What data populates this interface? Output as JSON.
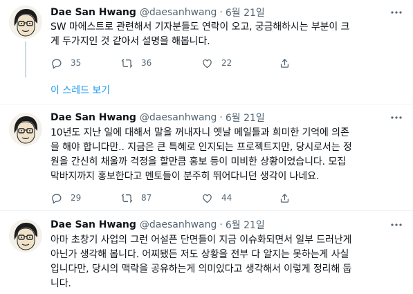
{
  "author": {
    "name": "Dae San Hwang",
    "handle": "@daesanhwang",
    "separator": "·"
  },
  "tweets": [
    {
      "date": "6월 21일",
      "lines": [
        "SW 마에스트로 관련해서 기자분들도 연락이 오고, 궁금해하시는 부분이 크",
        "게 두가지인 것 같아서 설명을 해봅니다."
      ],
      "replies": "35",
      "retweets": "36",
      "likes": "22"
    },
    {
      "date": "6월 21일",
      "lines": [
        "10년도 지난 일에 대해서 말을 꺼내자니 옛날 메일들과 희미한 기억에 의존",
        "을 해야 합니다만.. 지금은 큰 특혜로 인지되는 프로젝트지만, 당시로서는 정",
        "원을 간신히 채울까 걱정을 할만큼 홍보 등이 미비한 상황이었습니다. 모집",
        "막바지까지 홍보한다고 멘토들이 분주히 뛰어다니던 생각이 나네요."
      ],
      "replies": "29",
      "retweets": "87",
      "likes": "44"
    },
    {
      "date": "6월 21일",
      "lines": [
        "아마 초창기 사업의 그런 어설픈 단면들이 지금 이슈화되면서 일부 드러난게",
        "아닌가 생각해 봅니다. 어찌됐든 저도 상황을 전부 다 알지는 못하는게 사실",
        "입니다만, 당시의 맥락을 공유하는게 의미있다고 생각해서 이렇게 정리해 둡",
        "니다."
      ]
    }
  ],
  "show_thread_label": "이 스레드 보기",
  "icons": {
    "more": "more-horizontal-icon",
    "reply": "reply-icon",
    "retweet": "retweet-icon",
    "like": "heart-icon",
    "share": "share-icon"
  },
  "colors": {
    "text": "#0f1419",
    "secondary": "#536471",
    "link": "#1d9bf0",
    "thread_line": "#cfd9de",
    "divider": "#eff3f4"
  }
}
